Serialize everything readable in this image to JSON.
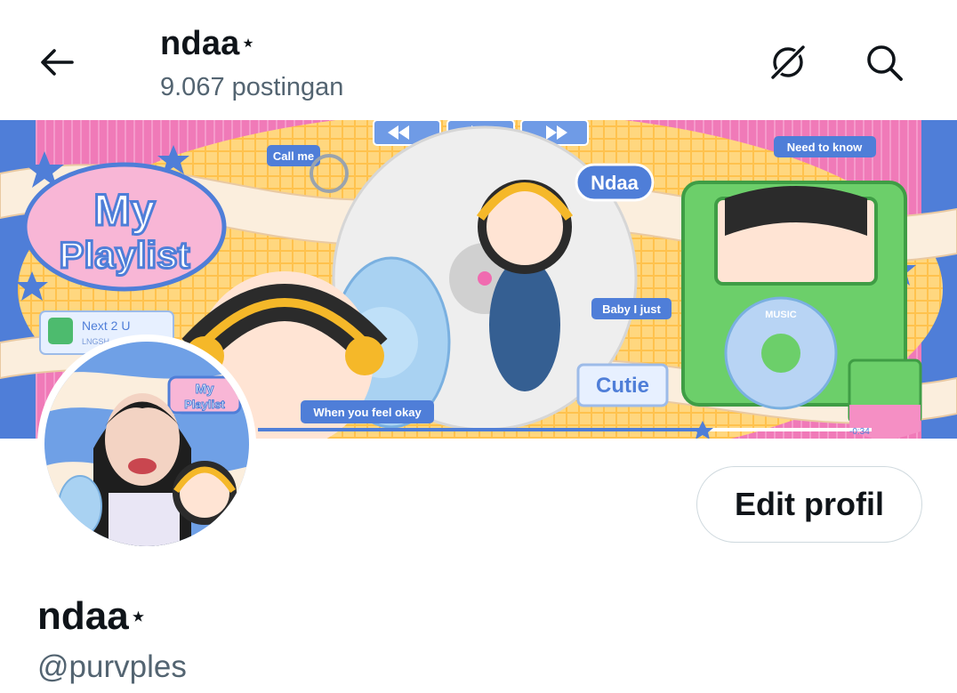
{
  "header": {
    "title": "ndaa",
    "title_star": "⋆",
    "post_count": "9.067 postingan"
  },
  "banner": {
    "badge_line1": "My",
    "badge_line2": "Playlist",
    "sticker_call_me": "Call me",
    "sticker_ndaa": "Ndaa",
    "sticker_need_to_know": "Need to know",
    "sticker_baby_i_just": "Baby I just",
    "sticker_cutie": "Cutie",
    "sticker_when_you_feel_okay": "When you feel okay",
    "player_label": "MUSIC",
    "now_playing": "Next 2 U",
    "now_playing_artist": "LNGSH",
    "time_remaining": "-0:34"
  },
  "avatar": {
    "badge_line1": "My",
    "badge_line2": "Playlist"
  },
  "profile": {
    "edit_button": "Edit profil",
    "display_name": "ndaa",
    "name_star": "⋆",
    "handle": "@purvples"
  },
  "icons": {
    "back": "arrow-left-icon",
    "grok": "grok-icon",
    "search": "search-icon"
  },
  "colors": {
    "text_primary": "#0f1419",
    "text_secondary": "#536471",
    "border": "#cfd9de",
    "banner_pink": "#f06bb0",
    "banner_blue": "#4f7ed8",
    "banner_yellow": "#ffcf6b",
    "player_green": "#6ccf6a"
  }
}
